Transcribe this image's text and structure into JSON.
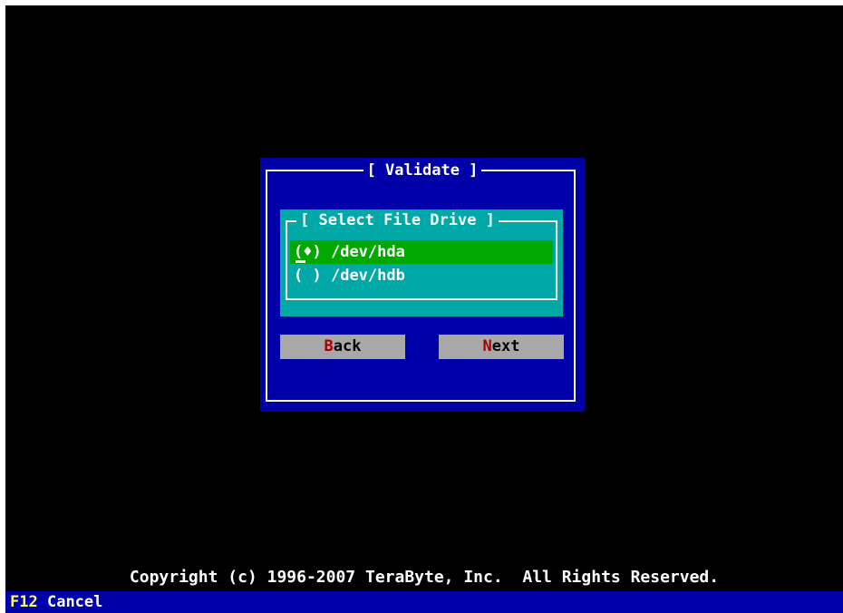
{
  "dialog": {
    "title": "[ Validate ]",
    "group": {
      "title": "[ Select File Drive ]",
      "options": [
        {
          "marker": "(♦)",
          "label": "/dev/hda",
          "selected": true
        },
        {
          "marker": "( )",
          "label": "/dev/hdb",
          "selected": false
        }
      ]
    },
    "buttons": {
      "back": {
        "hotkey": "B",
        "rest": "ack"
      },
      "next": {
        "hotkey": "N",
        "rest": "ext"
      }
    }
  },
  "footer": {
    "copyright": "Copyright (c) 1996-2007 TeraByte, Inc.  All Rights Reserved."
  },
  "statusbar": {
    "key": "F12",
    "label": "Cancel"
  },
  "colors": {
    "screen_bg": "#000000",
    "dialog_bg": "#0000a8",
    "group_bg": "#00a8a8",
    "selected_bg": "#00a800",
    "button_bg": "#a8a8a8",
    "hotkey": "#a80000",
    "status_key": "#ffff54"
  }
}
